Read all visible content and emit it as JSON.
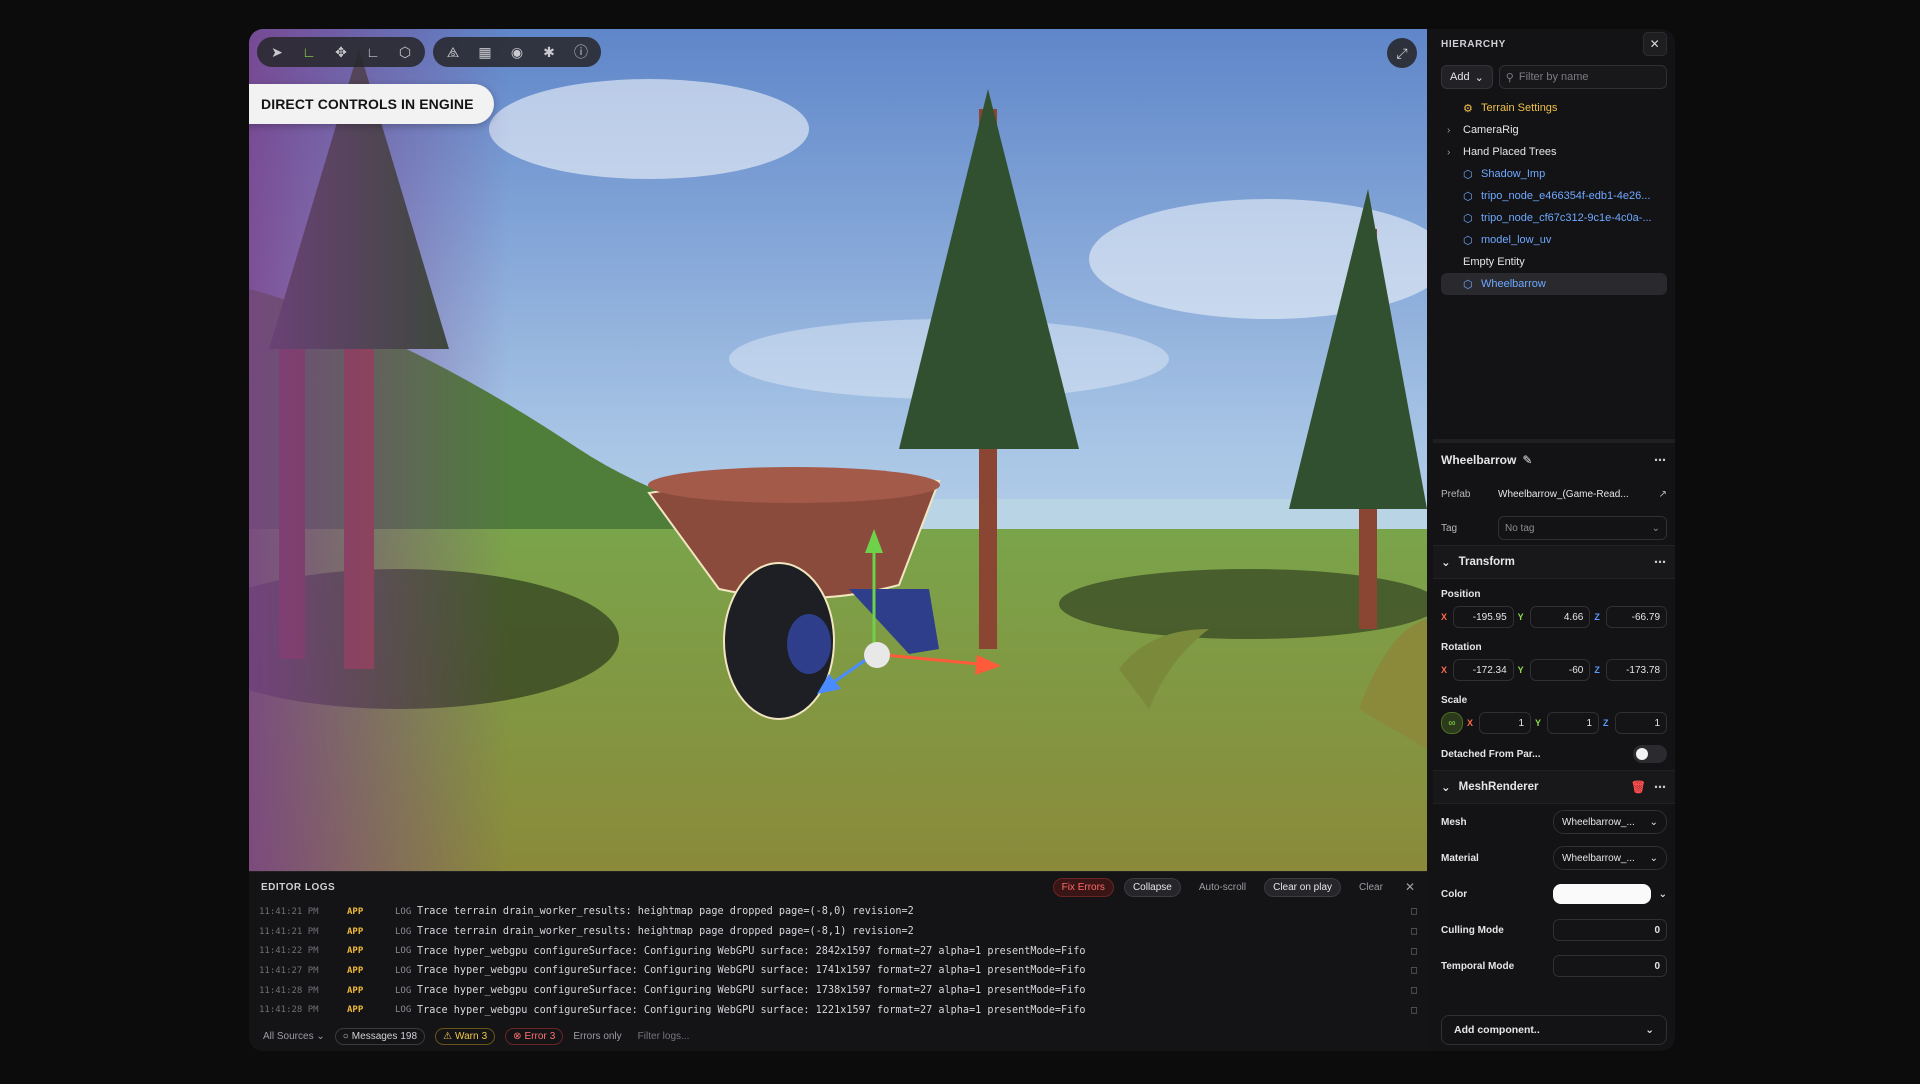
{
  "viewport": {
    "badge": "DIRECT CONTROLS IN ENGINE",
    "tools_left": [
      "select-icon",
      "move-icon",
      "rotate-icon",
      "scale-icon",
      "cube-icon"
    ],
    "tools_right": [
      "shape-icon",
      "grid-icon",
      "eye-icon",
      "person-icon",
      "info-icon"
    ]
  },
  "logs": {
    "title": "EDITOR LOGS",
    "buttons": {
      "fix_errors": "Fix Errors",
      "collapse": "Collapse",
      "auto_scroll": "Auto-scroll",
      "clear_on_play": "Clear on play",
      "clear": "Clear"
    },
    "rows": [
      {
        "time": "11:41:21 PM",
        "src": "APP",
        "lvl": "LOG",
        "msg": "Trace terrain drain_worker_results: heightmap page dropped page=(-8,0) revision=2"
      },
      {
        "time": "11:41:21 PM",
        "src": "APP",
        "lvl": "LOG",
        "msg": "Trace terrain drain_worker_results: heightmap page dropped page=(-8,1) revision=2"
      },
      {
        "time": "11:41:22 PM",
        "src": "APP",
        "lvl": "LOG",
        "msg": "Trace hyper_webgpu configureSurface: Configuring WebGPU surface: 2842x1597 format=27 alpha=1 presentMode=Fifo"
      },
      {
        "time": "11:41:27 PM",
        "src": "APP",
        "lvl": "LOG",
        "msg": "Trace hyper_webgpu configureSurface: Configuring WebGPU surface: 1741x1597 format=27 alpha=1 presentMode=Fifo"
      },
      {
        "time": "11:41:28 PM",
        "src": "APP",
        "lvl": "LOG",
        "msg": "Trace hyper_webgpu configureSurface: Configuring WebGPU surface: 1738x1597 format=27 alpha=1 presentMode=Fifo"
      },
      {
        "time": "11:41:28 PM",
        "src": "APP",
        "lvl": "LOG",
        "msg": "Trace hyper_webgpu configureSurface: Configuring WebGPU surface: 1221x1597 format=27 alpha=1 presentMode=Fifo"
      }
    ],
    "footer": {
      "all_sources": "All Sources",
      "messages_label": "Messages",
      "messages_count": "198",
      "warn_label": "Warn",
      "warn_count": "3",
      "error_label": "Error",
      "error_count": "3",
      "errors_only": "Errors only",
      "filter_placeholder": "Filter logs..."
    }
  },
  "hierarchy": {
    "title": "HIERARCHY",
    "add": "Add",
    "search_placeholder": "Filter by name",
    "items": [
      {
        "label": "Terrain Settings",
        "kind": "yellow",
        "chev": false
      },
      {
        "label": "CameraRig",
        "kind": "plain",
        "chev": true
      },
      {
        "label": "Hand Placed Trees",
        "kind": "plain",
        "chev": true
      },
      {
        "label": "Shadow_Imp",
        "kind": "blue",
        "chev": false
      },
      {
        "label": "tripo_node_e466354f-edb1-4e26...",
        "kind": "blue",
        "chev": false
      },
      {
        "label": "tripo_node_cf67c312-9c1e-4c0a-...",
        "kind": "blue",
        "chev": false
      },
      {
        "label": "model_low_uv",
        "kind": "blue",
        "chev": false
      },
      {
        "label": "Empty Entity",
        "kind": "plain",
        "chev": false
      },
      {
        "label": "Wheelbarrow",
        "kind": "blue",
        "chev": false,
        "selected": true
      }
    ]
  },
  "inspector": {
    "name": "Wheelbarrow",
    "prefab_label": "Prefab",
    "prefab_value": "Wheelbarrow_(Game-Read...",
    "tag_label": "Tag",
    "tag_value": "No tag",
    "transform": "Transform",
    "position_label": "Position",
    "position": {
      "x": "-195.95",
      "y": "4.66",
      "z": "-66.79"
    },
    "rotation_label": "Rotation",
    "rotation": {
      "x": "-172.34",
      "y": "-60",
      "z": "-173.78"
    },
    "scale_label": "Scale",
    "scale": {
      "x": "1",
      "y": "1",
      "z": "1"
    },
    "axis": {
      "x": "X",
      "y": "Y",
      "z": "Z"
    },
    "detached": "Detached From Par...",
    "mesh_renderer": "MeshRenderer",
    "mesh_label": "Mesh",
    "mesh_value": "Wheelbarrow_...",
    "material_label": "Material",
    "material_value": "Wheelbarrow_...",
    "color_label": "Color",
    "culling_label": "Culling Mode",
    "culling_value": "0",
    "temporal_label": "Temporal Mode",
    "temporal_value": "0",
    "add_component": "Add component.."
  }
}
